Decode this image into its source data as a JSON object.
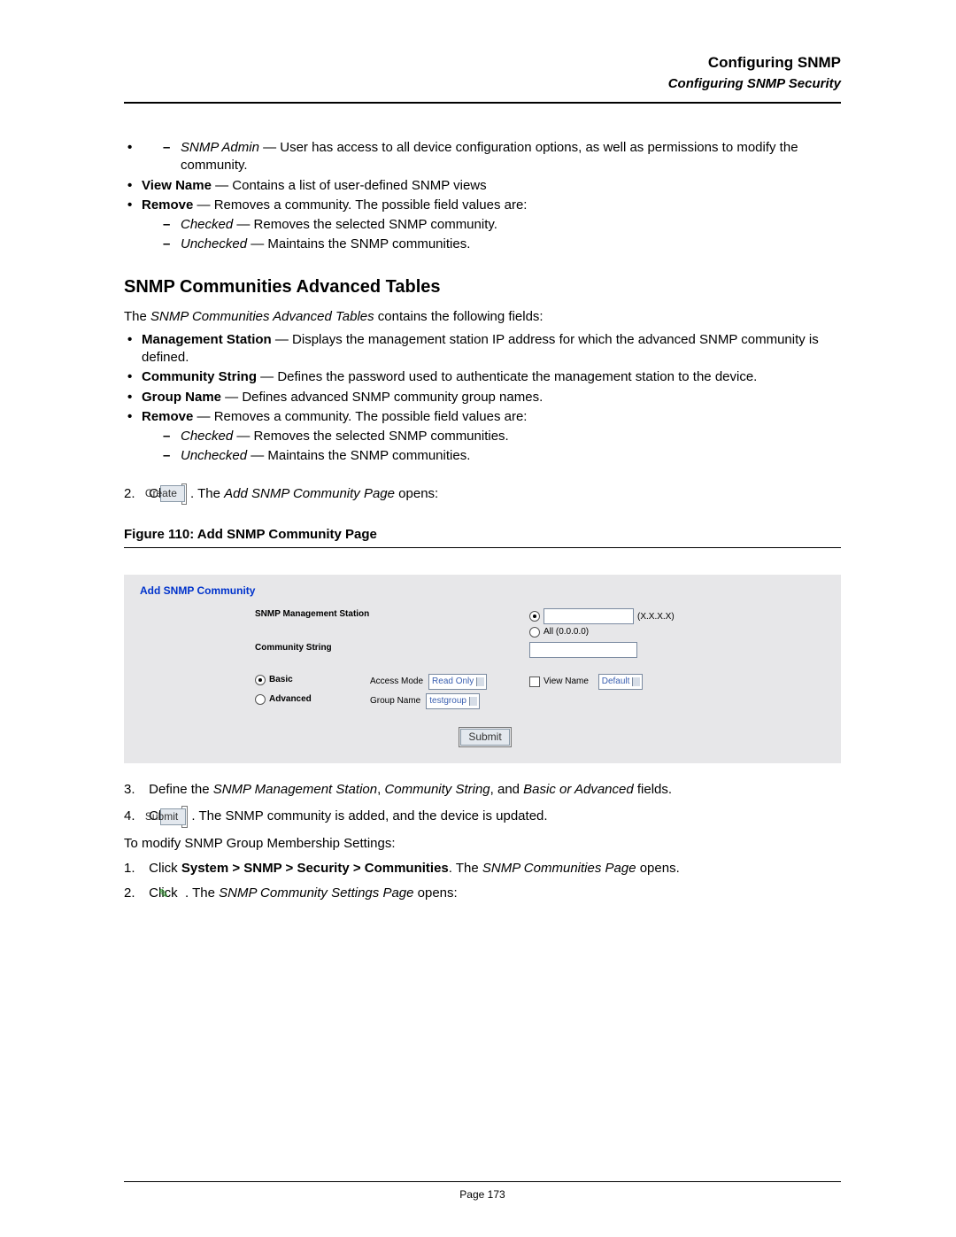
{
  "header": {
    "title": "Configuring SNMP",
    "subtitle": "Configuring SNMP Security"
  },
  "intro_list": {
    "snmp_admin_dash": "SNMP Admin",
    "snmp_admin_desc": " — User has access to all device configuration options, as well as permissions to modify the community.",
    "view_name_b": "View Name",
    "view_name_desc": " — Contains a list of user-defined SNMP views",
    "remove_b": "Remove",
    "remove_desc": " — Removes a community. The possible field values are:",
    "checked_i": "Checked",
    "checked_desc": " — Removes the selected SNMP community.",
    "unchecked_i": "Unchecked",
    "unchecked_desc": " — Maintains the SNMP communities."
  },
  "section_title": "SNMP Communities Advanced Tables",
  "section_intro_pre": "The ",
  "section_intro_i": "SNMP Communities Advanced Tables",
  "section_intro_post": " contains the following fields:",
  "adv_list": {
    "mgmt_b": "Management Station",
    "mgmt_desc": " — Displays the management station IP address for which the advanced SNMP community is defined.",
    "cs_b": "Community String",
    "cs_desc": " — Defines the password used to authenticate the management station to the device.",
    "gn_b": "Group Name",
    "gn_desc": " — Defines advanced SNMP community group names.",
    "remove_b": "Remove",
    "remove_desc": " — Removes a community. The possible field values are:",
    "checked_i": "Checked",
    "checked_desc": " — Removes the selected SNMP communities.",
    "unchecked_i": "Unchecked",
    "unchecked_desc": " — Maintains the SNMP communities."
  },
  "step2_pre": "Click ",
  "step2_btn": "Create",
  "step2_post1": ". The ",
  "step2_i": "Add SNMP Community Page",
  "step2_post2": " opens:",
  "figure_caption": "Figure 110: Add SNMP Community Page",
  "form": {
    "title": "Add SNMP Community",
    "mgmt_label": "SNMP Management Station",
    "xxxx": "(X.X.X.X)",
    "all_label": "All (0.0.0.0)",
    "cs_label": "Community String",
    "basic_label": "Basic",
    "advanced_label": "Advanced",
    "access_mode_label": "Access Mode",
    "access_mode_value": "Read Only",
    "group_name_label": "Group Name",
    "group_name_value": "testgroup",
    "view_name_label": "View Name",
    "view_name_value": "Default",
    "submit": "Submit"
  },
  "step3": {
    "pre": "Define the ",
    "i1": "SNMP Management Station",
    "sep1": ", ",
    "i2": "Community String",
    "sep2": ", and ",
    "i3": "Basic or Advanced",
    "post": " fields."
  },
  "step4_pre": "Click ",
  "step4_btn": "Submit",
  "step4_post": ". The SNMP community is added, and the device is updated.",
  "modify_line": "To modify SNMP Group Membership Settings:",
  "mod1_pre": "Click ",
  "mod1_b": "System > SNMP > Security > Communities",
  "mod1_mid": ". The ",
  "mod1_i": "SNMP Communities Page",
  "mod1_post": " opens.",
  "mod2_pre": "Click ",
  "mod2_mid": ". The ",
  "mod2_i": "SNMP Community Settings Page",
  "mod2_post": " opens:",
  "footer": "Page 173"
}
